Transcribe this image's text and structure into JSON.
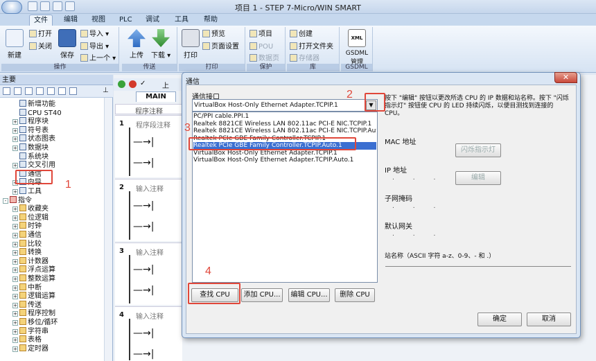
{
  "window": {
    "title": "项目 1 - STEP 7-Micro/WIN SMART"
  },
  "ribbon_tabs": [
    "文件",
    "编辑",
    "视图",
    "PLC",
    "调试",
    "工具",
    "帮助"
  ],
  "ribbon": {
    "groups": [
      {
        "label": "操作"
      },
      {
        "label": "传送"
      },
      {
        "label": "打印"
      },
      {
        "label": "保护"
      },
      {
        "label": "库"
      },
      {
        "label": "GSDML"
      }
    ],
    "new_label": "新建",
    "open_label": "打开",
    "close_label": "关闭",
    "save_label": "保存",
    "import_label": "导入",
    "export_label": "导出",
    "previous_label": "上一个",
    "upload_label": "上传",
    "download_label": "下载",
    "print_label": "打印",
    "preview_label": "预览",
    "page_setup_label": "页面设置",
    "project_label": "项目",
    "pou_label": "POU",
    "data_page_label": "数据页",
    "create_label": "创建",
    "open_folder_label": "打开文件夹",
    "memory_label": "存储器",
    "gsdml_label": "GSDML\n管理",
    "xml_icon_text": "XML"
  },
  "left_panel": {
    "title": "主要",
    "tree": [
      {
        "label": "新增功能",
        "indent": 1,
        "expand": ""
      },
      {
        "label": "CPU ST40",
        "indent": 1,
        "expand": ""
      },
      {
        "label": "程序块",
        "indent": 1,
        "expand": "+"
      },
      {
        "label": "符号表",
        "indent": 1,
        "expand": "+"
      },
      {
        "label": "状态图表",
        "indent": 1,
        "expand": "+"
      },
      {
        "label": "数据块",
        "indent": 1,
        "expand": "+"
      },
      {
        "label": "系统块",
        "indent": 1,
        "expand": ""
      },
      {
        "label": "交叉引用",
        "indent": 1,
        "expand": "+"
      },
      {
        "label": "通信",
        "indent": 1,
        "expand": ""
      },
      {
        "label": "向导",
        "indent": 1,
        "expand": "+"
      },
      {
        "label": "工具",
        "indent": 1,
        "expand": "+"
      },
      {
        "label": "指令",
        "indent": 0,
        "expand": "-"
      },
      {
        "label": "收藏夹",
        "indent": 1,
        "expand": "+"
      },
      {
        "label": "位逻辑",
        "indent": 1,
        "expand": "+"
      },
      {
        "label": "时钟",
        "indent": 1,
        "expand": "+"
      },
      {
        "label": "通信",
        "indent": 1,
        "expand": "+"
      },
      {
        "label": "比较",
        "indent": 1,
        "expand": "+"
      },
      {
        "label": "转换",
        "indent": 1,
        "expand": "+"
      },
      {
        "label": "计数器",
        "indent": 1,
        "expand": "+"
      },
      {
        "label": "浮点运算",
        "indent": 1,
        "expand": "+"
      },
      {
        "label": "整数运算",
        "indent": 1,
        "expand": "+"
      },
      {
        "label": "中断",
        "indent": 1,
        "expand": "+"
      },
      {
        "label": "逻辑运算",
        "indent": 1,
        "expand": "+"
      },
      {
        "label": "传送",
        "indent": 1,
        "expand": "+"
      },
      {
        "label": "程序控制",
        "indent": 1,
        "expand": "+"
      },
      {
        "label": "移位/循环",
        "indent": 1,
        "expand": "+"
      },
      {
        "label": "字符串",
        "indent": 1,
        "expand": "+"
      },
      {
        "label": "表格",
        "indent": 1,
        "expand": "+"
      },
      {
        "label": "定时器",
        "indent": 1,
        "expand": "+"
      }
    ]
  },
  "editor": {
    "tab": "MAIN",
    "program_comment": "程序注释",
    "networks": [
      {
        "num": "1",
        "comment": "程序段注释"
      },
      {
        "num": "2",
        "comment": "输入注释"
      },
      {
        "num": "3",
        "comment": "输入注释"
      },
      {
        "num": "4",
        "comment": "输入注释"
      }
    ],
    "toolbar_text": "上"
  },
  "dialog": {
    "title": "通信",
    "close": "✕",
    "interface_label": "通信接口",
    "selected_interface": "VirtualBox Host-Only Ethernet Adapter.TCPIP.1",
    "interfaces": [
      "PC/PPI cable.PPI.1",
      "Realtek 8821CE Wireless LAN 802.11ac PCI-E NIC.TCPIP.1",
      "Realtek 8821CE Wireless LAN 802.11ac PCI-E NIC.TCPIP.Auto.1",
      "Realtek PCIe GBE Family Controller.TCPIP.1",
      "Realtek PCIe GBE Family Controller.TCPIP.Auto.1",
      "VirtualBox Host-Only Ethernet Adapter.TCPIP.1",
      "VirtualBox Host-Only Ethernet Adapter.TCPIP.Auto.1"
    ],
    "selected_index": 4,
    "help_text": "按下 \"编辑\" 按钮以更改所选 CPU 的 IP 数据和站名称。按下 \"闪烁指示灯\" 按钮使 CPU 的 LED 持续闪烁，以便目测找到连接的 CPU。",
    "mac_label": "MAC 地址",
    "flash_button": "闪烁指示灯",
    "ip_label": "IP 地址",
    "edit_button": "编辑",
    "subnet_label": "子网掩码",
    "gateway_label": "默认网关",
    "station_label": "站名称（ASCII 字符 a-z、0-9、- 和 .）",
    "ip_dots": ". . .",
    "find_cpu": "查找 CPU",
    "add_cpu": "添加 CPU...",
    "edit_cpu": "编辑 CPU...",
    "delete_cpu": "删除 CPU",
    "ok": "确定",
    "cancel": "取消"
  },
  "annotations": [
    "1",
    "2",
    "3",
    "4"
  ],
  "colors": {
    "highlight": "#e0473a",
    "selection": "#3b6fd1"
  }
}
